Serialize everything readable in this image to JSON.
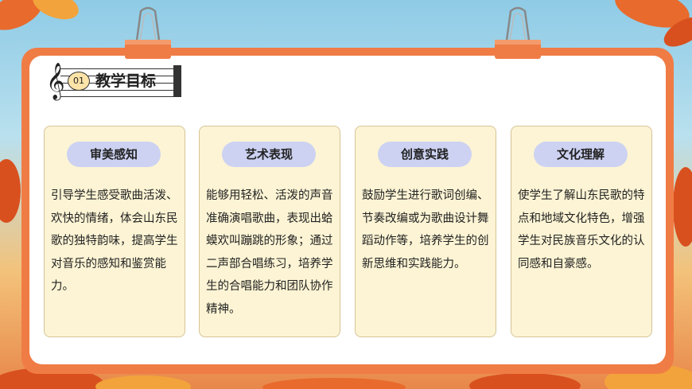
{
  "header": {
    "section_number": "01",
    "title": "教学目标"
  },
  "cards": [
    {
      "label": "审美感知",
      "text": "引导学生感受歌曲活泼、欢快的情绪，体会山东民歌的独特韵味，提高学生对音乐的感知和鉴赏能力。"
    },
    {
      "label": "艺术表现",
      "text": "能够用轻松、活泼的声音准确演唱歌曲，表现出蛤蟆欢叫蹦跳的形象；通过二声部合唱练习，培养学生的合唱能力和团队协作精神。"
    },
    {
      "label": "创意实践",
      "text": "鼓励学生进行歌词创编、节奏改编或为歌曲设计舞蹈动作等，培养学生的创新思维和实践能力。"
    },
    {
      "label": "文化理解",
      "text": "使学生了解山东民歌的特点和地域文化特色，增强学生对民族音乐文化的认同感和自豪感。"
    }
  ],
  "colors": {
    "frame": "#f07c45",
    "card": "#fcf4d4",
    "pill": "#cdd2f2",
    "badge": "#fce3a8"
  },
  "icons": [
    "binder-clip-icon",
    "treble-clef-icon",
    "autumn-leaves-decoration"
  ]
}
